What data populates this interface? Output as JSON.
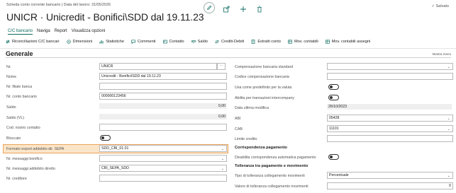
{
  "header": {
    "breadcrumb": "Scheda conto corrente bancario | Data del lavoro: 31/05/2026",
    "title": "UNICR · Unicredit - Bonifici\\SDD dal 19.11.23",
    "saved_label": "Salvato",
    "icons": [
      "edit-icon",
      "share-icon",
      "add-icon",
      "delete-icon"
    ]
  },
  "tabs": [
    {
      "label": "C/C bancario",
      "active": true
    },
    {
      "label": "Naviga",
      "active": false
    },
    {
      "label": "Report",
      "active": false
    },
    {
      "label": "Visualizza opzioni",
      "active": false
    }
  ],
  "actions": [
    {
      "label": "Riconciliazioni C/C bancari",
      "icon": "reconcile-icon"
    },
    {
      "label": "Dimensioni",
      "icon": "dimensions-icon"
    },
    {
      "label": "Statistiche",
      "icon": "statistics-icon"
    },
    {
      "label": "Commenti",
      "icon": "comments-icon"
    },
    {
      "label": "Contatto",
      "icon": "contact-icon"
    },
    {
      "label": "Saldo",
      "icon": "balance-icon"
    },
    {
      "label": "Crediti-Debiti",
      "icon": "credit-debit-icon"
    },
    {
      "label": "Estratti conto",
      "icon": "statements-icon"
    },
    {
      "label": "Mov. contabili",
      "icon": "ledger-icon"
    },
    {
      "label": "Mov. contabili assegni",
      "icon": "check-ledger-icon"
    }
  ],
  "section": {
    "title": "Generale",
    "show_more": "Mostra meno"
  },
  "left_fields": {
    "nr": {
      "label": "Nr.",
      "value": "UNICR"
    },
    "nome": {
      "label": "Nome",
      "value": "Unicredit - Bonifici\\SDD dal 19.11.23"
    },
    "nr_filiale": {
      "label": "Nr. filiale banca",
      "value": ""
    },
    "nr_conto": {
      "label": "Nr. conto bancario",
      "value": "000000123456"
    },
    "saldo": {
      "label": "Saldo",
      "value": "0,00"
    },
    "saldo_vl": {
      "label": "Saldo (VL)",
      "value": "0,00"
    },
    "cod_contatto": {
      "label": "Cod. nostro contatto",
      "value": ""
    },
    "bloccato": {
      "label": "Bloccato"
    },
    "formato_export": {
      "label": "Formato export addebito dir. SEPA",
      "value": "SDD_CBI_01.01"
    },
    "nr_msg_bonifico": {
      "label": "Nr. messaggi bonifico",
      "value": ""
    },
    "nr_msg_addebito": {
      "label": "Nr. messaggi addebito diretto",
      "value": "CBI_SEPA_SDD"
    },
    "nr_creditore": {
      "label": "Nr. creditore",
      "value": ""
    }
  },
  "right_fields": {
    "compensazione": {
      "label": "Compensazione bancaria standard",
      "value": ""
    },
    "codice_comp": {
      "label": "Codice compensazione bancaria",
      "value": ""
    },
    "usa_predefinito": {
      "label": "Usa come predefinito per la valuta"
    },
    "abilita_interc": {
      "label": "Abilita per transazioni intercompany"
    },
    "data_modifica": {
      "label": "Data ultima modifica",
      "value": "26/10/2023"
    },
    "abi": {
      "label": "ABI",
      "value": "05428"
    },
    "cab": {
      "label": "CAB",
      "value": "11101"
    },
    "limite_credito": {
      "label": "Limite credito",
      "value": ""
    },
    "corrispondenza_title": "Corrispondenza pagamento",
    "disabilita": {
      "label": "Disabilita corrispondenza automatica pagamento"
    },
    "tolleranza_title": "Tolleranza tra pagamento e movimento",
    "tipo_tolleranza": {
      "label": "Tipo di tolleranza collegamento movimenti",
      "value": "Percentuale"
    },
    "valore_tolleranza": {
      "label": "Valore di tolleranza collegamento movimenti",
      "value": "0"
    }
  },
  "colors": {
    "accent": "#0a6b5f",
    "highlight_bg": "#fbe5c9",
    "highlight_border": "#eba35a"
  }
}
